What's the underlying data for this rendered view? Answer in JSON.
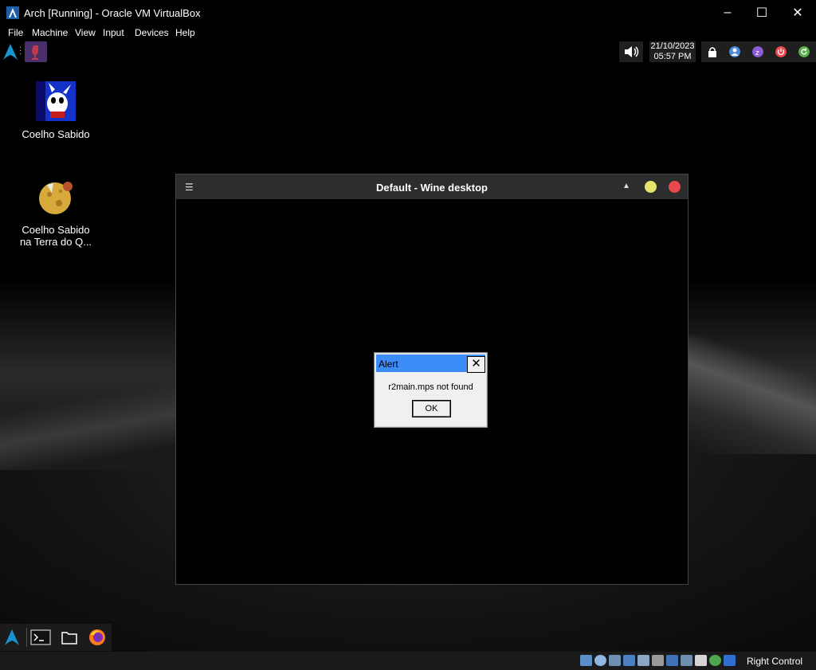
{
  "host_window": {
    "title": "Arch [Running] - Oracle VM VirtualBox",
    "controls": {
      "minimize": "–",
      "maximize": "☐",
      "close": "✕"
    }
  },
  "host_menu": [
    "File",
    "Machine",
    "View",
    "Input",
    "Devices",
    "Help"
  ],
  "guest_panel": {
    "clock_date": "21/10/2023",
    "clock_time": "05:57 PM",
    "tray_icons": [
      "lock-icon",
      "user-icon",
      "switch-user-icon",
      "power-icon",
      "restart-icon"
    ]
  },
  "desktop_icons": [
    {
      "label": "Coelho Sabido",
      "icon": "rabbit-app-icon"
    },
    {
      "label": "Coelho Sabido na Terra do Q...",
      "icon": "rabbit-cheese-app-icon"
    }
  ],
  "wine_window": {
    "title": "Default - Wine desktop"
  },
  "alert": {
    "title": "Alert",
    "message": "r2main.mps not found",
    "ok_label": "OK",
    "close_glyph": "✕"
  },
  "taskbar": {
    "items": [
      "arch-menu-icon",
      "terminal-icon",
      "file-manager-icon",
      "firefox-icon"
    ]
  },
  "host_status": {
    "host_key_label": "Right Control"
  },
  "colors": {
    "alert_title_bg": "#3c8dfa",
    "arch_blue": "#1793d1",
    "wine_close": "#e84a4f",
    "wine_minimize": "#e6e36a"
  }
}
